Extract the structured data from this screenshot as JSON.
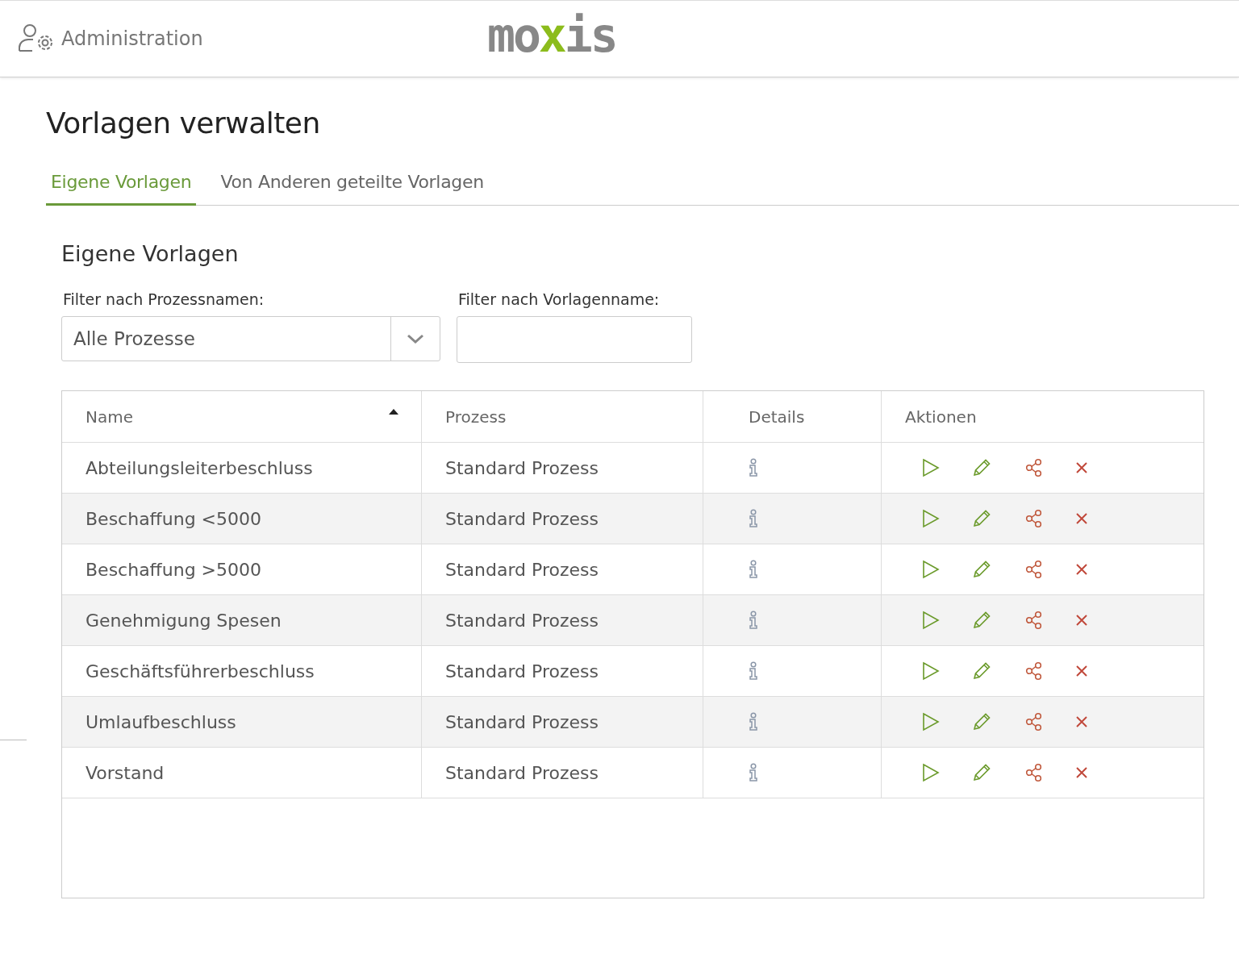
{
  "header": {
    "section": "Administration",
    "logo": [
      {
        "text": "mo",
        "accent": false
      },
      {
        "text": "x",
        "accent": true
      },
      {
        "text": "is",
        "accent": false
      }
    ]
  },
  "page_title": "Vorlagen verwalten",
  "tabs": [
    {
      "label": "Eigene Vorlagen",
      "selected": true
    },
    {
      "label": "Von Anderen geteilte Vorlagen",
      "selected": false
    }
  ],
  "panel_title": "Eigene Vorlagen",
  "filters": [
    {
      "kind": "dropdown",
      "label": "Filter nach Prozessnamen:",
      "value": "Alle Prozesse"
    },
    {
      "kind": "text",
      "label": "Filter nach Vorlagenname:"
    }
  ],
  "table": {
    "columns": [
      {
        "label": "Name",
        "sorted": true
      },
      {
        "label": "Prozess",
        "sorted": false
      },
      {
        "label": "Details",
        "sorted": false
      },
      {
        "label": "Aktionen",
        "sorted": false
      }
    ],
    "rows": [
      {
        "name": "Abteilungsleiterbeschluss",
        "process": "Standard Prozess"
      },
      {
        "name": "Beschaffung <5000",
        "process": "Standard Prozess"
      },
      {
        "name": "Beschaffung >5000",
        "process": "Standard Prozess"
      },
      {
        "name": "Genehmigung Spesen",
        "process": "Standard Prozess"
      },
      {
        "name": "Geschäftsführerbeschluss",
        "process": "Standard Prozess"
      },
      {
        "name": "Umlaufbeschluss",
        "process": "Standard Prozess"
      },
      {
        "name": "Vorstand",
        "process": "Standard Prozess"
      }
    ]
  }
}
